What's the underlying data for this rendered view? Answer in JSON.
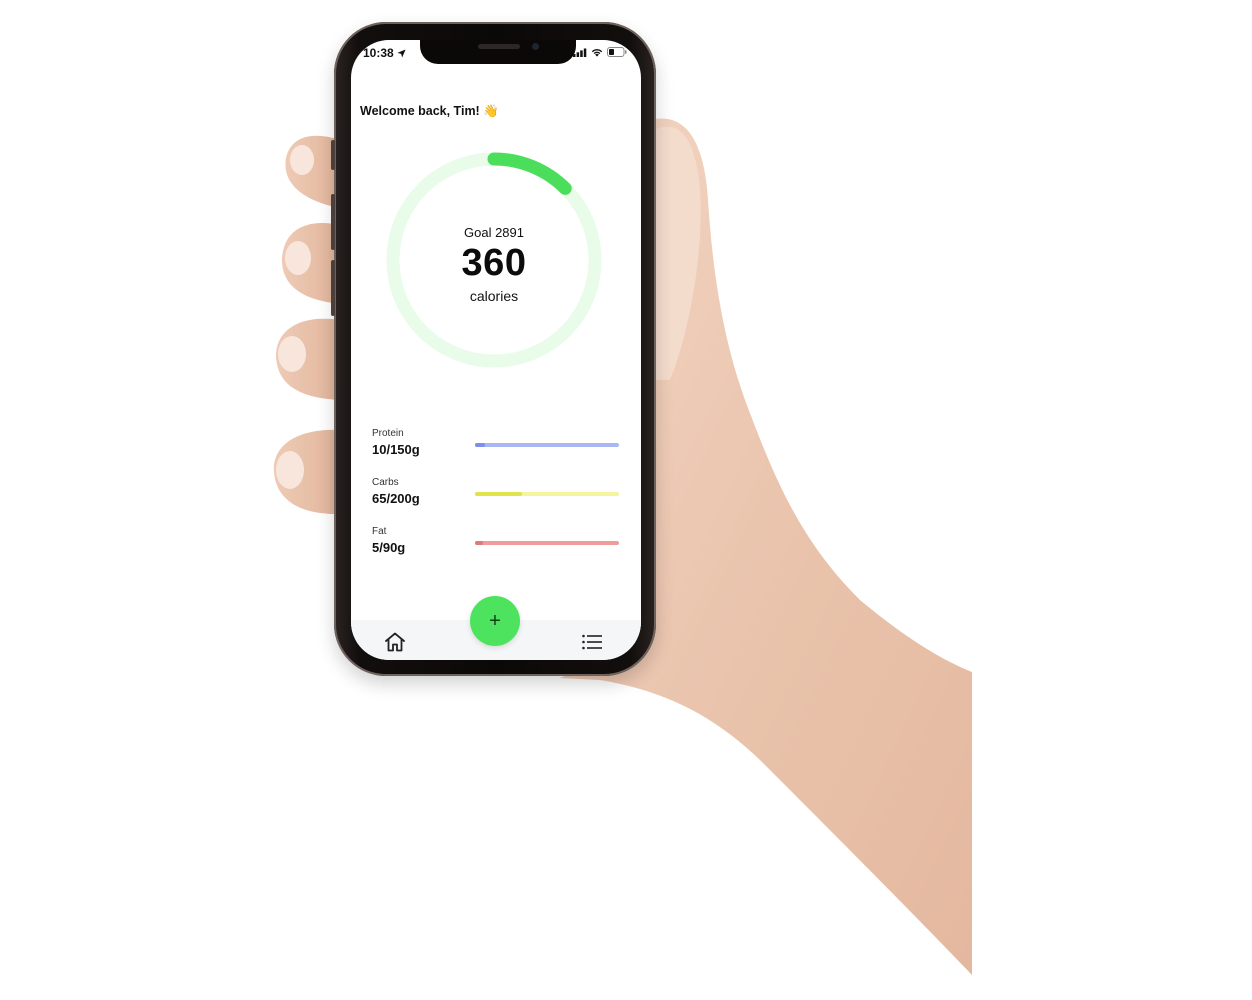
{
  "status_bar": {
    "time": "10:38",
    "icons": [
      "location-arrow-icon",
      "signal-icon",
      "wifi-icon",
      "battery-icon"
    ]
  },
  "greeting": {
    "text": "Welcome back, Tim!",
    "emoji": "👋"
  },
  "calorie_ring": {
    "goal_label": "Goal 2891",
    "goal": 2891,
    "value": "360",
    "unit": "calories",
    "progress_color": "#4ade5a",
    "track_color": "#e9fbe9"
  },
  "macros": [
    {
      "name": "Protein",
      "amount": "10/150g",
      "current": 10,
      "target": 150,
      "color": "#7f8fe8",
      "track_color": "#aab7f3"
    },
    {
      "name": "Carbs",
      "amount": "65/200g",
      "current": 65,
      "target": 200,
      "color": "#e0e34a",
      "track_color": "#f4f59d"
    },
    {
      "name": "Fat",
      "amount": "5/90g",
      "current": 5,
      "target": 90,
      "color": "#e07a7a",
      "track_color": "#ef9c9c"
    }
  ],
  "tab_bar": {
    "left_icon": "home-icon",
    "right_icon": "list-icon",
    "fab_label": "+"
  },
  "colors": {
    "accent": "#4de35e"
  }
}
